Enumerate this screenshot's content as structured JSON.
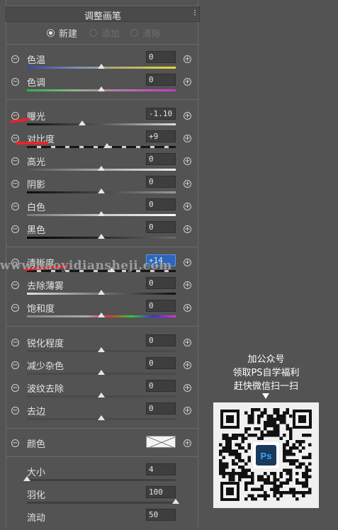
{
  "panel": {
    "title": "调整画笔",
    "menu_glyph": "⁝",
    "modes": [
      {
        "label": "新建",
        "selected": true,
        "enabled": true
      },
      {
        "label": "添加",
        "selected": false,
        "enabled": false
      },
      {
        "label": "清除",
        "selected": false,
        "enabled": false
      }
    ],
    "sliders": {
      "temperature": {
        "label": "色温",
        "value": "0",
        "level": 0.5
      },
      "tint": {
        "label": "色调",
        "value": "0",
        "level": 0.5
      },
      "exposure": {
        "label": "曝光",
        "value": "-1.10",
        "level": 0.37
      },
      "contrast": {
        "label": "对比度",
        "value": "+9",
        "level": 0.54
      },
      "highlights": {
        "label": "高光",
        "value": "0",
        "level": 0.5
      },
      "shadows": {
        "label": "阴影",
        "value": "0",
        "level": 0.5
      },
      "whites": {
        "label": "白色",
        "value": "0",
        "level": 0.5
      },
      "blacks": {
        "label": "黑色",
        "value": "0",
        "level": 0.5
      },
      "clarity": {
        "label": "清晰度",
        "value": "+14",
        "level": 0.57
      },
      "dehaze": {
        "label": "去除薄雾",
        "value": "0",
        "level": 0.5
      },
      "saturation": {
        "label": "饱和度",
        "value": "0",
        "level": 0.5
      },
      "sharpness": {
        "label": "锐化程度",
        "value": "0",
        "level": 0.5
      },
      "noise": {
        "label": "减少杂色",
        "value": "0",
        "level": 0.5
      },
      "moire": {
        "label": "波纹去除",
        "value": "0",
        "level": 0.5
      },
      "defringe": {
        "label": "去边",
        "value": "0",
        "level": 0.5
      }
    },
    "color": {
      "label": "颜色"
    },
    "brush": {
      "size": {
        "label": "大小",
        "value": "4",
        "level": 0.0
      },
      "feather": {
        "label": "羽化",
        "value": "100",
        "level": 1.0
      },
      "flow": {
        "label": "流动",
        "value": "50"
      }
    }
  },
  "watermark": "www.naoyidiansheji.com",
  "promo": {
    "line1": "加公众号",
    "line2": "领取PS自学福利",
    "line3": "赶快微信扫一扫",
    "qr_badge": "Ps"
  },
  "colors": {
    "panel_bg": "#535353",
    "input_bg": "#3e3e3e",
    "focus_blue": "#2b66b8",
    "annotation_red": "#e8242a"
  }
}
